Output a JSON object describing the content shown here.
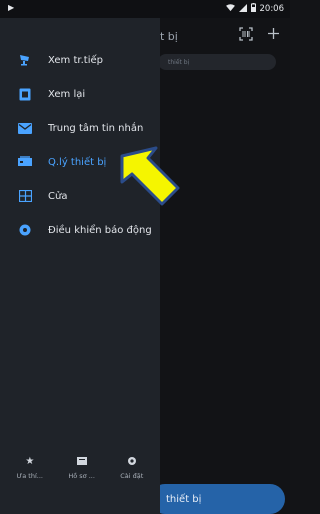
{
  "status_bar": {
    "time": "20:06"
  },
  "main": {
    "title": "t bị",
    "search_placeholder": "thiết bị",
    "bottom_button": "thiết bị"
  },
  "drawer": {
    "items": [
      {
        "label": "Xem tr.tiếp",
        "icon": "live-view-icon"
      },
      {
        "label": "Xem lại",
        "icon": "playback-icon"
      },
      {
        "label": "Trung tâm tin nhắn",
        "icon": "message-icon"
      },
      {
        "label": "Q.lý thiết bị",
        "icon": "device-manage-icon",
        "active": true
      },
      {
        "label": "Cửa",
        "icon": "door-icon"
      },
      {
        "label": "Điều khiển báo động",
        "icon": "alarm-icon"
      }
    ],
    "footer": [
      {
        "label": "Ưa thí...",
        "icon": "star-icon"
      },
      {
        "label": "Hồ sơ ...",
        "icon": "folder-icon"
      },
      {
        "label": "Cài đặt",
        "icon": "gear-icon"
      }
    ]
  },
  "colors": {
    "accent": "#4aa3ff",
    "arrow_fill": "#f5f500",
    "arrow_stroke": "#2b4c8a"
  }
}
